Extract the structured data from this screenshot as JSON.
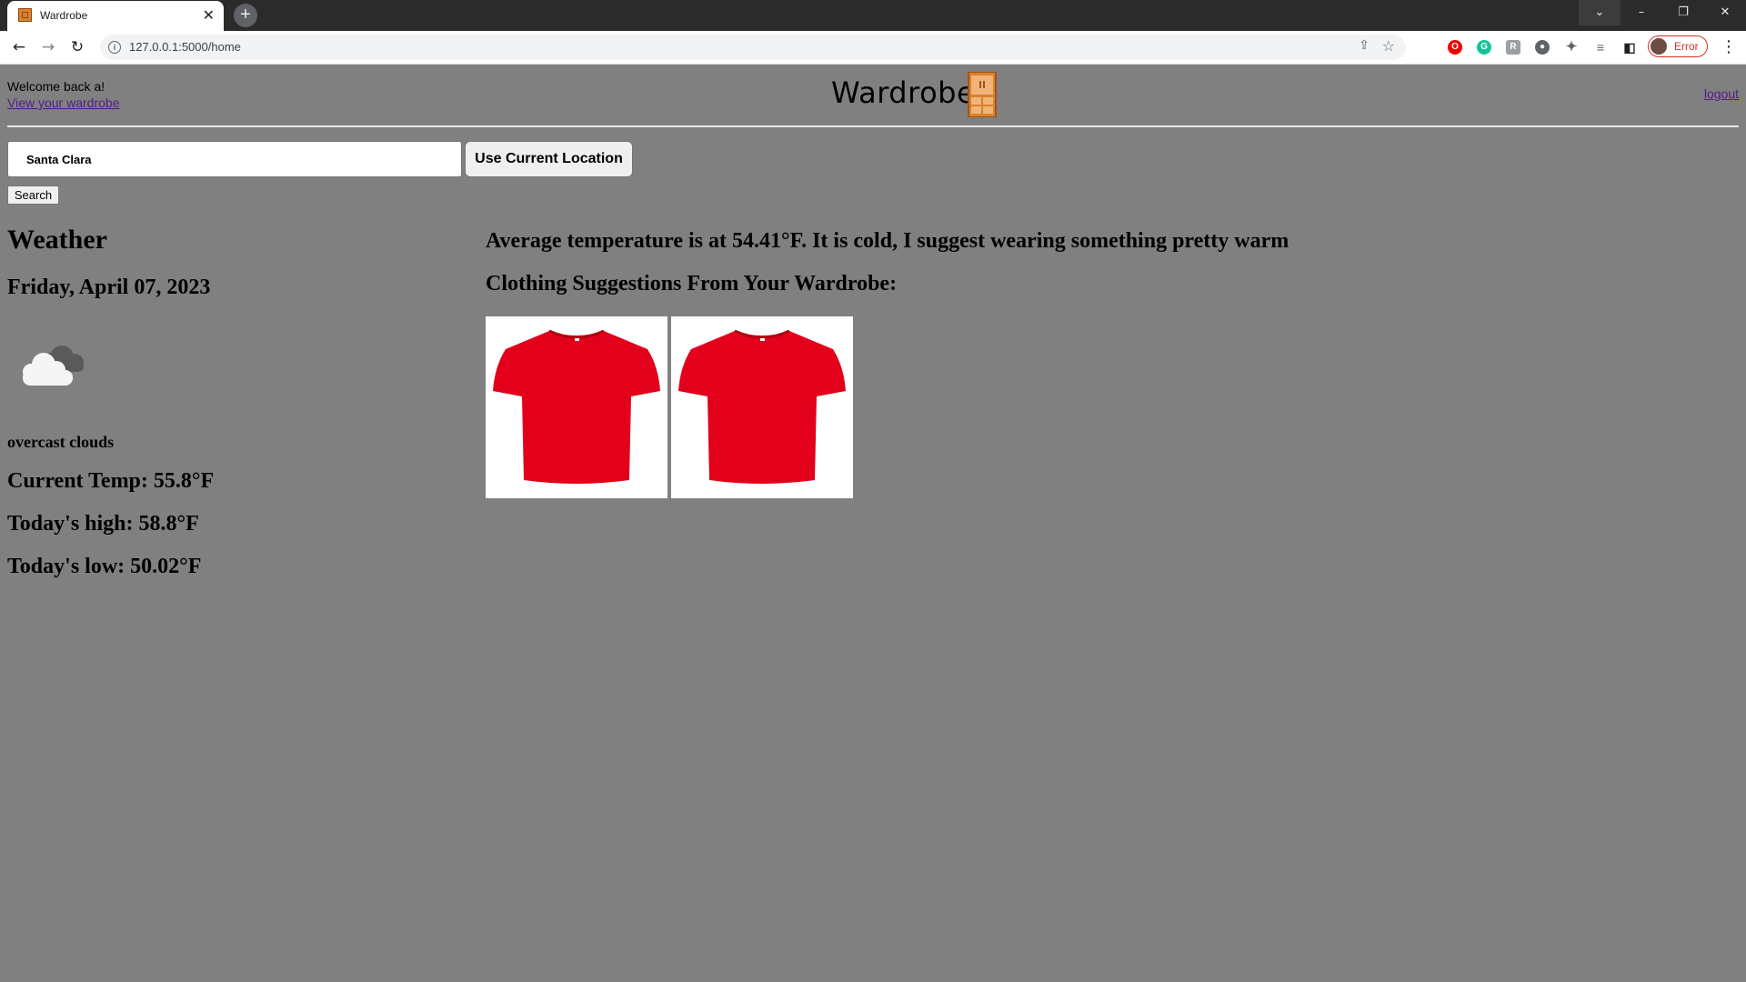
{
  "browser": {
    "tab_title": "Wardrobe",
    "tab_close": "✕",
    "new_tab": "+",
    "url": "127.0.0.1:5000/home",
    "profile_label": "Error",
    "window_controls": [
      "⌄",
      "–",
      "❐",
      "✕"
    ]
  },
  "header": {
    "welcome": "Welcome back a!",
    "wardrobe_link": "View your wardrobe",
    "logo_text": "Wardrobe",
    "logout_link": "logout"
  },
  "search": {
    "city_value": "Santa Clara",
    "location_button": "Use Current Location",
    "search_button": "Search"
  },
  "weather": {
    "heading": "Weather",
    "date": "Friday, April 07, 2023",
    "icon": "overcast-cloud-icon",
    "description": "overcast clouds",
    "current_temp": "Current Temp: 55.8°F",
    "high": "Today's high: 58.8°F",
    "low": "Today's low: 50.02°F"
  },
  "suggestions": {
    "average_text": "Average temperature is at 54.41°F. It is cold, I suggest wearing something pretty warm",
    "heading": "Clothing Suggestions From Your Wardrobe:",
    "items": [
      {
        "icon": "red-tshirt-image",
        "color": "#e2001a"
      },
      {
        "icon": "red-tshirt-image",
        "color": "#e2001a"
      }
    ]
  },
  "colors": {
    "page_background": "#808080",
    "link": "#551a8b",
    "logo_accent": "#d9822b",
    "profile_error": "#d93025"
  }
}
